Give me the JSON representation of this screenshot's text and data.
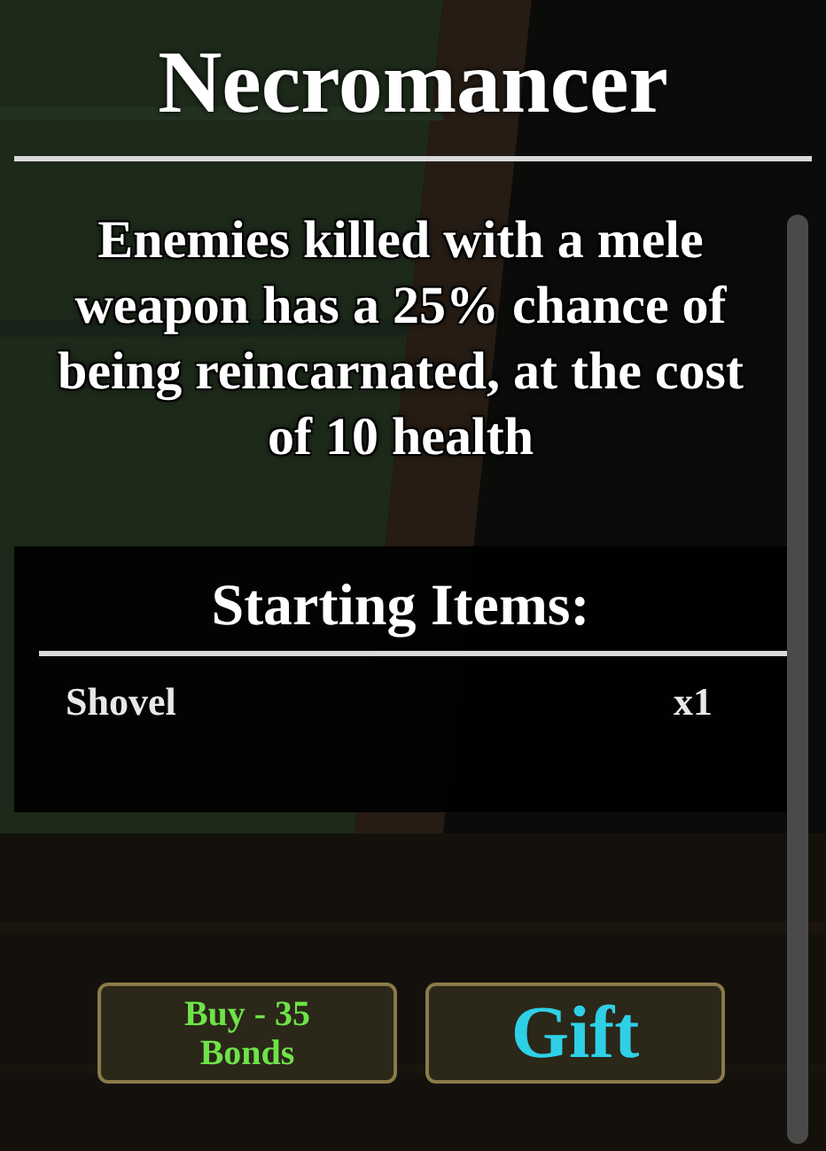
{
  "title": "Necromancer",
  "description": "Enemies killed with a mele weapon has a 25% chance of being reincarnated, at the cost of 10 health",
  "starting_items": {
    "heading": "Starting Items:",
    "items": [
      {
        "name": "Shovel",
        "quantity": "x1"
      }
    ]
  },
  "buttons": [
    {
      "kind": "buy",
      "label": "Buy - 35 Bonds"
    },
    {
      "kind": "gift",
      "label": "Gift"
    }
  ]
}
